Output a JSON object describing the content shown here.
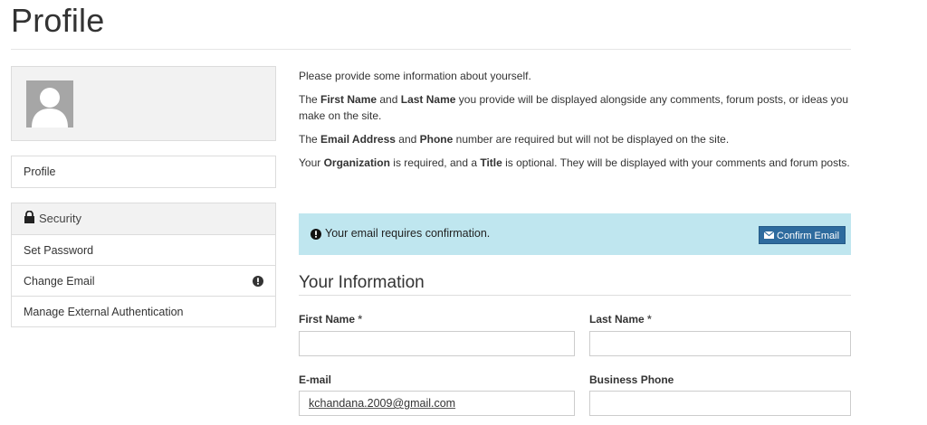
{
  "page": {
    "title": "Profile"
  },
  "sidebar": {
    "profile_label": "Profile",
    "security_header": "Security",
    "security_items": [
      {
        "label": "Set Password"
      },
      {
        "label": "Change Email"
      },
      {
        "label": "Manage External Authentication"
      }
    ]
  },
  "intro": {
    "line1": "Please provide some information about yourself.",
    "p2": {
      "a": "The ",
      "b1": "First Name",
      "c": " and ",
      "b2": "Last Name",
      "d": " you provide will be displayed alongside any comments, forum posts, or ideas you make on the site."
    },
    "p3": {
      "a": "The ",
      "b1": "Email Address",
      "c": " and ",
      "b2": "Phone",
      "d": " number are required but will not be displayed on the site."
    },
    "p4": {
      "a": "Your ",
      "b1": "Organization",
      "c": " is required, and a ",
      "b2": "Title",
      "d": " is optional. They will be displayed with your comments and forum posts."
    }
  },
  "alert": {
    "message": "Your email requires confirmation.",
    "button_label": "Confirm Email",
    "background": "#bfe6ef",
    "button_color": "#2e6b9e"
  },
  "form": {
    "section_title": "Your Information",
    "first_name": {
      "label": "First Name",
      "required_mark": "*",
      "value": ""
    },
    "last_name": {
      "label": "Last Name",
      "required_mark": "*",
      "value": ""
    },
    "email": {
      "label": "E-mail",
      "value": "kchandana.2009@gmail.com"
    },
    "business_phone": {
      "label": "Business Phone",
      "value": ""
    }
  }
}
